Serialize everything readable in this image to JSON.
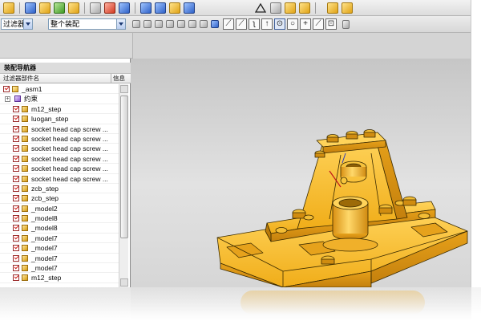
{
  "colors": {
    "app_background": "#d4d4d4",
    "part_yellow": "#f2b21f",
    "part_edge": "#3a2a00",
    "check_red": "#d0201a",
    "viewport_gray": "#d5d5d5"
  },
  "toolbar_top": {
    "icons": [
      "open-icon",
      "assembly-icon",
      "component-icon",
      "constraint-icon",
      "reposition-icon",
      "arrange-icon",
      "explode-icon",
      "sequence-icon",
      "measure-icon",
      "section-icon",
      "triangle-icon",
      "drawing-icon",
      "render-icon",
      "sketch-icon"
    ]
  },
  "toolbar_select": {
    "filter_value": "过滤器",
    "scope_value": "整个装配",
    "snap_icons": [
      "line-snap-icon",
      "point-snap-icon",
      "curve-snap-icon",
      "arrow-snap-icon",
      "circle-snap-icon",
      "center-snap-icon",
      "plus-snap-icon",
      "slash-snap-icon",
      "select-snap-icon",
      "layer-icon"
    ]
  },
  "navigator": {
    "title": "装配导航器",
    "col_name": "过滤器部件名",
    "col_info": "信息",
    "rows": [
      {
        "label": "_asm1",
        "type": "asm",
        "level": 0,
        "check": true
      },
      {
        "label": "约束",
        "type": "con",
        "level": 1,
        "check": false,
        "expander": "+"
      },
      {
        "label": "m12_step",
        "type": "part",
        "level": 1,
        "check": true
      },
      {
        "label": "luogan_step",
        "type": "part",
        "level": 1,
        "check": true
      },
      {
        "label": "socket head cap screw ...",
        "type": "part",
        "level": 1,
        "check": true
      },
      {
        "label": "socket head cap screw ...",
        "type": "part",
        "level": 1,
        "check": true
      },
      {
        "label": "socket head cap screw ...",
        "type": "part",
        "level": 1,
        "check": true
      },
      {
        "label": "socket head cap screw ...",
        "type": "part",
        "level": 1,
        "check": true
      },
      {
        "label": "socket head cap screw ...",
        "type": "part",
        "level": 1,
        "check": true
      },
      {
        "label": "socket head cap screw ...",
        "type": "part",
        "level": 1,
        "check": true
      },
      {
        "label": "zcb_step",
        "type": "part",
        "level": 1,
        "check": true
      },
      {
        "label": "zcb_step",
        "type": "part",
        "level": 1,
        "check": true
      },
      {
        "label": "_model2",
        "type": "part",
        "level": 1,
        "check": true
      },
      {
        "label": "_model8",
        "type": "part",
        "level": 1,
        "check": true
      },
      {
        "label": "_model8",
        "type": "part",
        "level": 1,
        "check": true
      },
      {
        "label": "_model7",
        "type": "part",
        "level": 1,
        "check": true
      },
      {
        "label": "_model7",
        "type": "part",
        "level": 1,
        "check": true
      },
      {
        "label": "_model7",
        "type": "part",
        "level": 1,
        "check": true
      },
      {
        "label": "_model7",
        "type": "part",
        "level": 1,
        "check": true
      },
      {
        "label": "m12_step",
        "type": "part",
        "level": 1,
        "check": true
      }
    ]
  },
  "viewport": {
    "model_parts": [
      "base-plate",
      "vertical-support",
      "cylinder-bushing",
      "clamp-bar",
      "bolts"
    ]
  }
}
